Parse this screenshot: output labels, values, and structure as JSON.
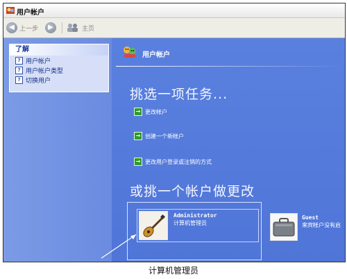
{
  "window": {
    "title": "用户帐户"
  },
  "toolbar": {
    "back_label": "上一步",
    "home_label": "主页"
  },
  "sidebar": {
    "heading": "了解",
    "items": [
      {
        "label": "用户帐户",
        "icon": "help-icon"
      },
      {
        "label": "用户帐户类型",
        "icon": "help-icon"
      },
      {
        "label": "切换用户",
        "icon": "help-icon"
      }
    ]
  },
  "main": {
    "header_title": "用户帐户",
    "pick_task_heading": "挑选一项任务...",
    "tasks": [
      {
        "label": "更改帐户"
      },
      {
        "label": "创建一个新帐户"
      },
      {
        "label": "更改用户登录或注销的方式"
      }
    ],
    "pick_account_heading": "或挑一个帐户做更改",
    "accounts": [
      {
        "name": "Administrator",
        "role": "计算机管理员"
      },
      {
        "name": "Guest",
        "role": "来宾帐户没有启"
      }
    ]
  },
  "caption": "计算机管理员",
  "colors": {
    "main_bg": "#5a80df",
    "sidebar_bg": "#7b9be6",
    "task_arrow": "#2f9b2b"
  }
}
